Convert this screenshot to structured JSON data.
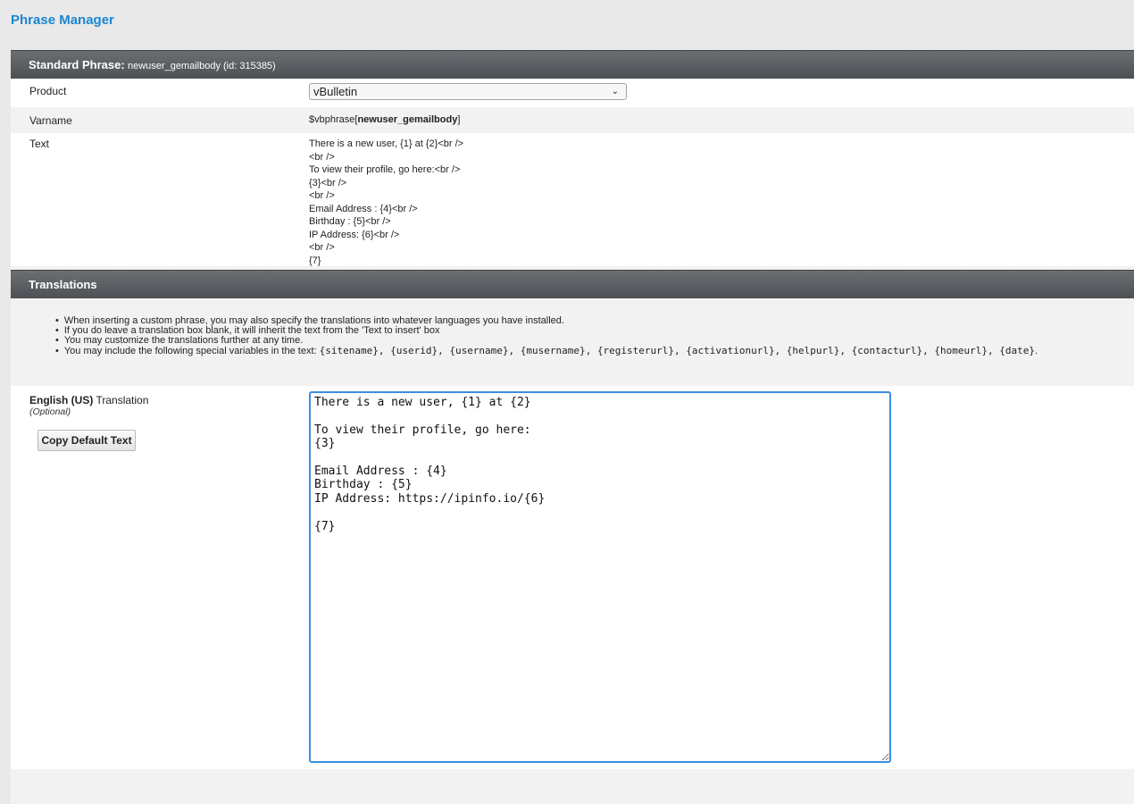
{
  "page_title": "Phrase Manager",
  "standard_phrase": {
    "header_label": "Standard Phrase:",
    "header_detail": "newuser_gemailbody (id: 315385)",
    "product_label": "Product",
    "product_value": "vBulletin",
    "varname_label": "Varname",
    "varname_prefix": "$vbphrase[",
    "varname_name": "newuser_gemailbody",
    "varname_suffix": "]",
    "text_label": "Text",
    "text_lines": [
      "There is a new user, {1} at {2}<br />",
      "<br />",
      "To view their profile, go here:<br />",
      "{3}<br />",
      "<br />",
      "Email Address : {4}<br />",
      "Birthday : {5}<br />",
      "IP Address: {6}<br />",
      "<br />",
      "{7}"
    ]
  },
  "translations": {
    "header": "Translations",
    "notes": [
      "When inserting a custom phrase, you may also specify the translations into whatever languages you have installed.",
      "If you do leave a translation box blank, it will inherit the text from the 'Text to insert' box",
      "You may customize the translations further at any time.",
      "You may include the following special variables in the text:"
    ],
    "special_variables": "{sitename}, {userid}, {username}, {musername}, {registerurl}, {activationurl}, {helpurl}, {contacturl}, {homeurl}, {date}",
    "language_bold": "English (US)",
    "language_rest": " Translation",
    "optional_label": "(Optional)",
    "copy_button": "Copy Default Text",
    "textarea_value": "There is a new user, {1} at {2}\n\nTo view their profile, go here:\n{3}\n\nEmail Address : {4}\nBirthday : {5}\nIP Address: https://ipinfo.io/{6}\n\n{7}"
  },
  "colors": {
    "title_blue": "#1b86d1",
    "header_bar": "#54575b",
    "focus_border": "#3b8ee0"
  }
}
